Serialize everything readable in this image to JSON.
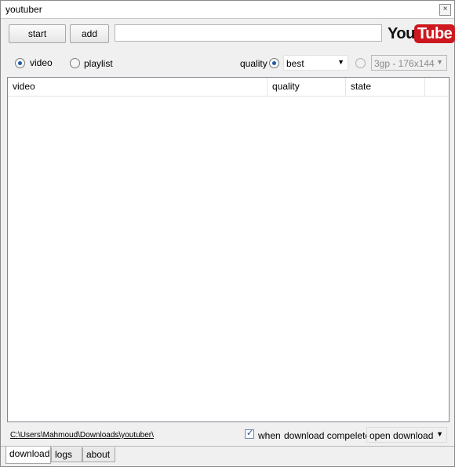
{
  "window": {
    "title": "youtuber",
    "close_glyph": "×"
  },
  "toolbar": {
    "start_label": "start",
    "add_label": "add",
    "url_value": ""
  },
  "logo": {
    "part1": "You",
    "part2": "Tube",
    "accent": "#cc181e"
  },
  "options": {
    "mode_video_label": "video",
    "mode_playlist_label": "playlist",
    "mode_selected": "video",
    "quality_label": "quality",
    "quality_value": "best",
    "format_value": "3gp - 176x144"
  },
  "table": {
    "columns": [
      "video",
      "quality",
      "state"
    ],
    "rows": []
  },
  "footer": {
    "path": "C:\\Users\\Mahmoud\\Downloads\\youtuber\\",
    "checkbox_checked": true,
    "when_label": "when",
    "download_complete_label": "download compelete",
    "action_value": "open downloads folder"
  },
  "tabs": [
    {
      "label": "download",
      "active": true
    },
    {
      "label": "logs",
      "active": false
    },
    {
      "label": "about",
      "active": false
    }
  ],
  "icons": {
    "radio": "radio-icon",
    "dropdown": "chevron-down-icon",
    "checkbox": "checkmark-icon"
  }
}
